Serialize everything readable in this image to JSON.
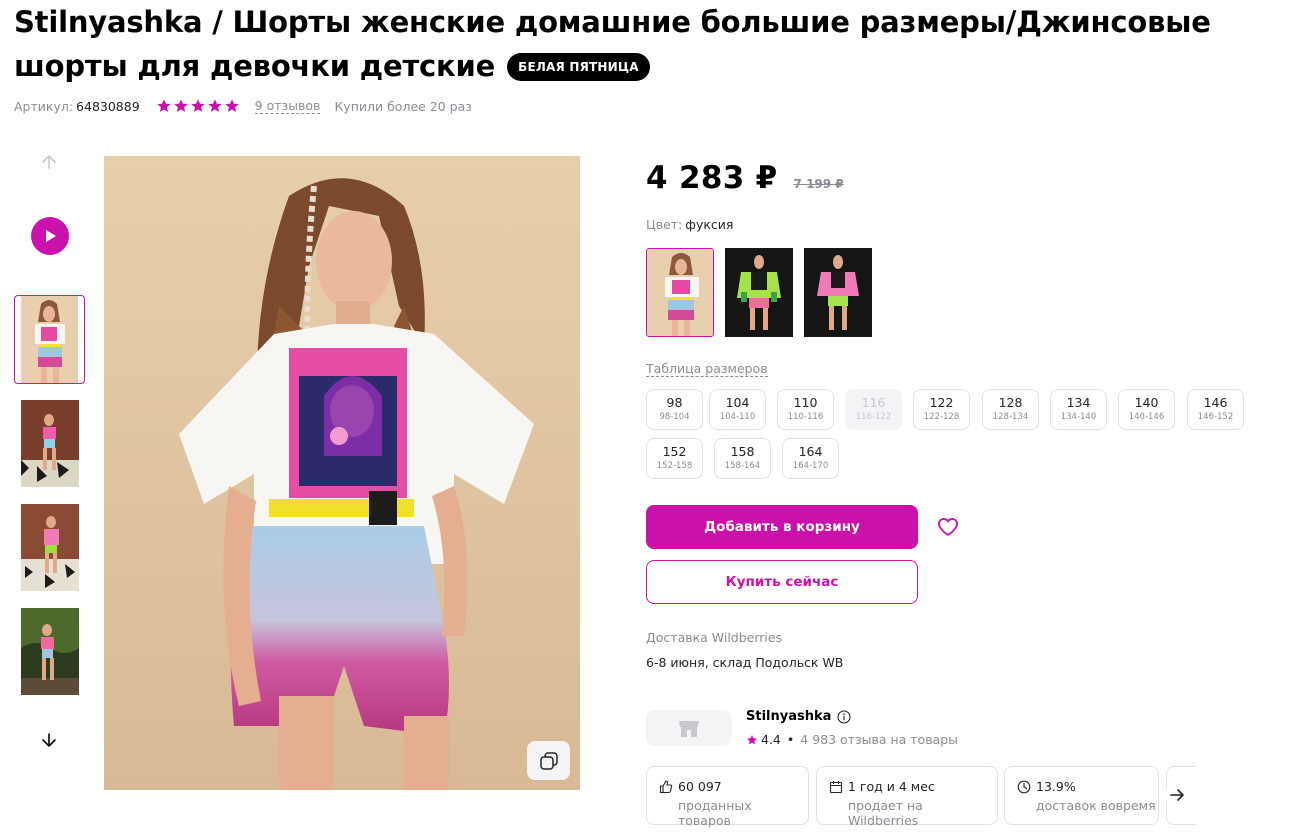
{
  "product": {
    "title": "Stilnyashka / Шорты женские домашние большие размеры/Джинсовые шорты для девочки детские",
    "badge": "БЕЛАЯ ПЯТНИЦА",
    "article_label": "Артикул:",
    "article_value": "64830889",
    "rating_stars": 5,
    "reviews": "9 отзывов",
    "bought": "Купили более 20 раз"
  },
  "price": {
    "current": "4 283 ₽",
    "old": "7 199 ₽"
  },
  "color": {
    "label": "Цвет:",
    "value": "фуксия"
  },
  "sizes": {
    "table_label": "Таблица размеров",
    "items": [
      {
        "size": "98",
        "range": "98-104",
        "available": true
      },
      {
        "size": "104",
        "range": "104-110",
        "available": true
      },
      {
        "size": "110",
        "range": "110-116",
        "available": true
      },
      {
        "size": "116",
        "range": "116-122",
        "available": false
      },
      {
        "size": "122",
        "range": "122-128",
        "available": true
      },
      {
        "size": "128",
        "range": "128-134",
        "available": true
      },
      {
        "size": "134",
        "range": "134-140",
        "available": true
      },
      {
        "size": "140",
        "range": "140-146",
        "available": true
      },
      {
        "size": "146",
        "range": "146-152",
        "available": true
      },
      {
        "size": "152",
        "range": "152-158",
        "available": true
      },
      {
        "size": "158",
        "range": "158-164",
        "available": true
      },
      {
        "size": "164",
        "range": "164-170",
        "available": true
      }
    ]
  },
  "actions": {
    "add_to_cart": "Добавить в корзину",
    "buy_now": "Купить сейчас"
  },
  "delivery": {
    "label": "Доставка Wildberries",
    "value": "6-8 июня, склад Подольск WB"
  },
  "seller": {
    "name": "Stilnyashka",
    "rating": "4.4",
    "reviews": "4 983 отзыва на товары"
  },
  "stats": [
    {
      "value": "60 097",
      "label": "проданных товаров",
      "icon": "thumbs-up-icon"
    },
    {
      "value": "1 год и 4 мес",
      "label": "продает на Wildberries",
      "icon": "calendar-icon"
    },
    {
      "value": "13.9%",
      "label": "доставок вовремя",
      "icon": "clock-icon"
    }
  ],
  "theme": {
    "accent": "#cb11ab",
    "muted": "#8b8b96",
    "text": "#242424"
  }
}
